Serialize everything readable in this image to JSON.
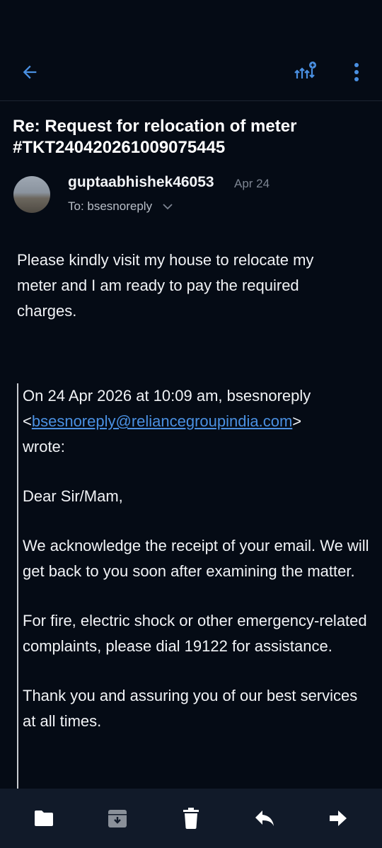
{
  "email": {
    "subject": "Re: Request for relocation of meter #TKT240420261009075445",
    "sender": "guptaabhishek46053",
    "date": "Apr 24",
    "to": "To: bsesnoreply",
    "body": "Please kindly visit my house to relocate my meter and I am ready to pay the required charges.",
    "quote": {
      "header_prefix": "On 24 Apr 2026 at 10:09 am, bsesnoreply",
      "email_link": "bsesnoreply@reliancegroupindia.com",
      "wrote": "wrote:",
      "greeting": "Dear Sir/Mam,",
      "para1": "We acknowledge the receipt of your email. We will get back to you soon after examining the matter.",
      "para2": "For fire, electric shock or other emergency-related complaints, please dial 19122 for assistance.",
      "para3": "Thank you and assuring you of our best services at all times."
    }
  },
  "colors": {
    "accent": "#4a90e2",
    "background": "#050b15",
    "bottom_bar": "#111a29"
  },
  "icons": {
    "top": [
      "back-arrow-icon",
      "track-package-icon",
      "more-vert-icon"
    ],
    "bottom": [
      "folder-icon",
      "archive-icon",
      "trash-icon",
      "reply-icon",
      "forward-icon"
    ]
  }
}
